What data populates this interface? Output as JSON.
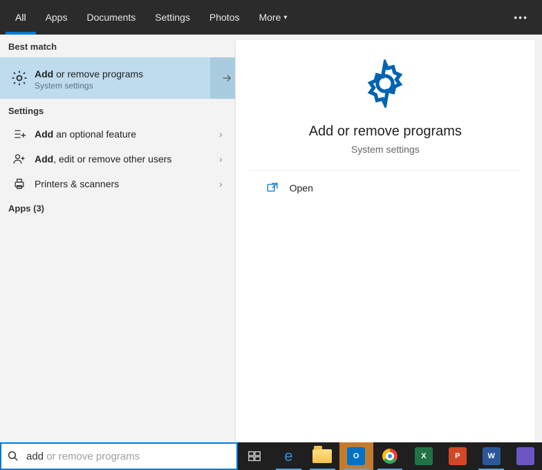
{
  "tabs": {
    "items": [
      "All",
      "Apps",
      "Documents",
      "Settings",
      "Photos",
      "More"
    ],
    "active_index": 0
  },
  "left": {
    "best_match_header": "Best match",
    "selected": {
      "title_bold": "Add",
      "title_rest": " or remove programs",
      "subtitle": "System settings"
    },
    "settings_header": "Settings",
    "settings_items": [
      {
        "bold": "Add",
        "rest": " an optional feature",
        "icon": "list-add-icon"
      },
      {
        "bold": "Add",
        "rest": ", edit or remove other users",
        "icon": "user-add-icon"
      },
      {
        "bold": "",
        "rest": "Printers & scanners",
        "icon": "printer-icon"
      }
    ],
    "apps_header": "Apps (3)"
  },
  "right": {
    "title": "Add or remove programs",
    "subtitle": "System settings",
    "open_label": "Open"
  },
  "search": {
    "typed": "add",
    "completion": " or remove programs"
  },
  "taskbar": {
    "items": [
      {
        "name": "task-view",
        "badge": "",
        "active": false
      },
      {
        "name": "internet-explorer",
        "badge": "",
        "active": true
      },
      {
        "name": "file-explorer",
        "badge": "",
        "active": true
      },
      {
        "name": "outlook",
        "badge": "O",
        "active": true,
        "orange": true,
        "bg": "#0072c6"
      },
      {
        "name": "chrome",
        "badge": "",
        "active": true
      },
      {
        "name": "excel",
        "badge": "X",
        "active": false,
        "bg": "#217346"
      },
      {
        "name": "powerpoint",
        "badge": "P",
        "active": false,
        "bg": "#d24726"
      },
      {
        "name": "word",
        "badge": "W",
        "active": true,
        "bg": "#2b579a"
      },
      {
        "name": "app-other",
        "badge": "",
        "active": false,
        "bg": "#6b56c4"
      }
    ]
  }
}
